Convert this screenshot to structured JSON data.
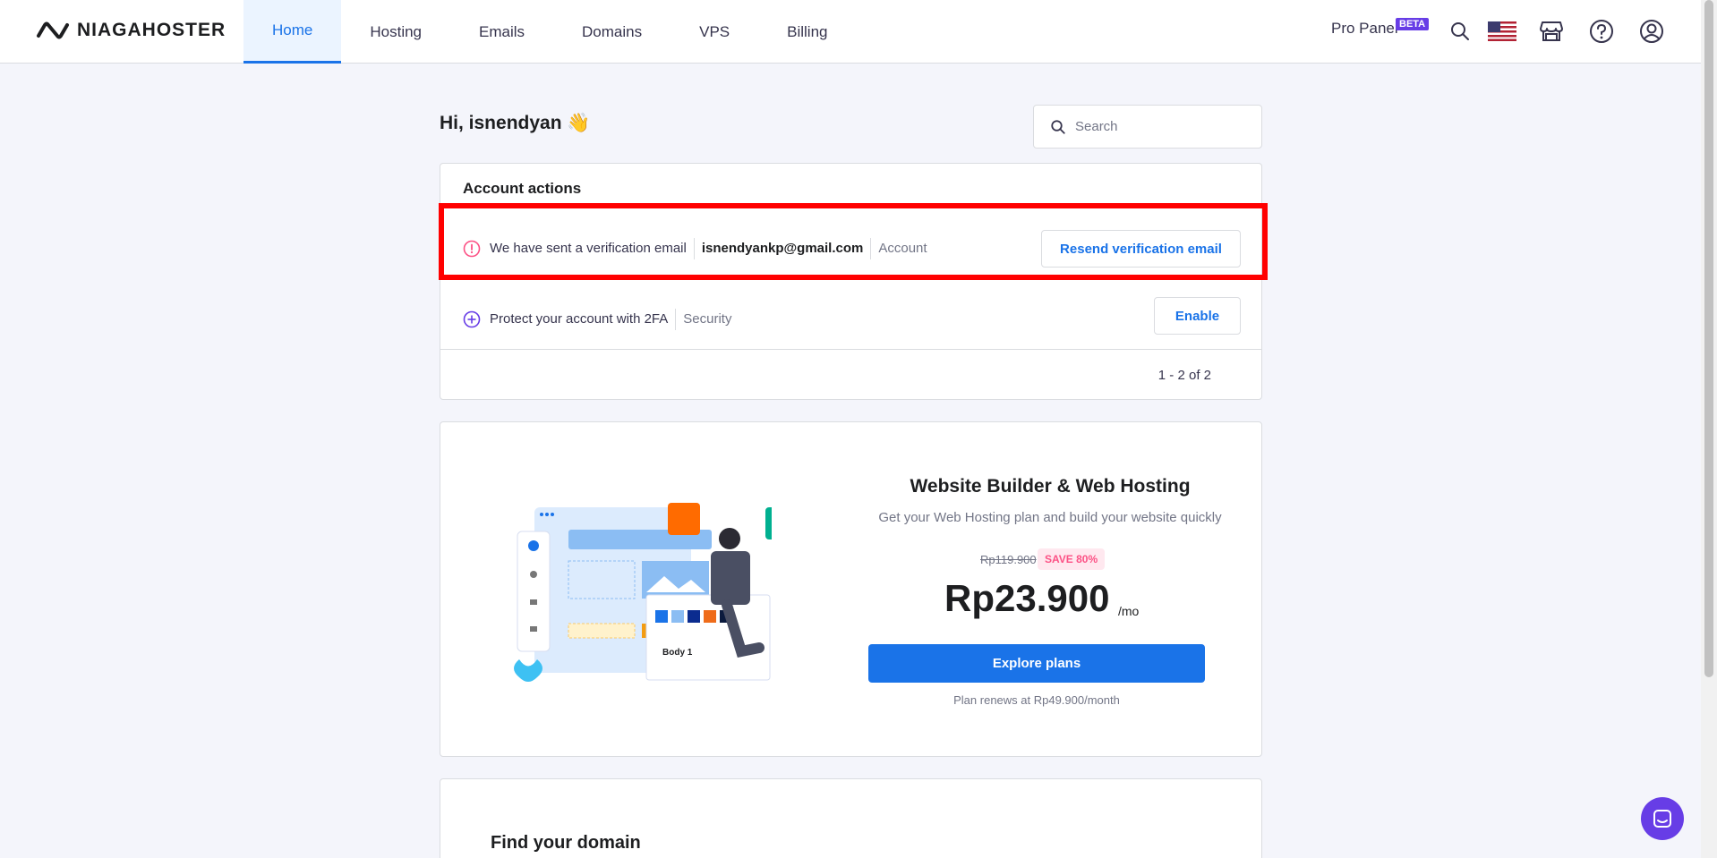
{
  "header": {
    "brand": "NIAGAHOSTER",
    "nav": [
      {
        "label": "Home",
        "active": true
      },
      {
        "label": "Hosting"
      },
      {
        "label": "Emails"
      },
      {
        "label": "Domains"
      },
      {
        "label": "VPS"
      },
      {
        "label": "Billing"
      }
    ],
    "pro_panel": "Pro Panel",
    "badge": "BETA",
    "icons": [
      "search-icon",
      "flag-us-icon",
      "store-icon",
      "help-icon",
      "account-icon"
    ]
  },
  "greeting": "Hi, isnendyan 👋",
  "search": {
    "placeholder": "Search"
  },
  "account_actions": {
    "title": "Account actions",
    "rows": [
      {
        "text": "We have sent a verification email",
        "email": "isnendyankp@gmail.com",
        "category": "Account",
        "button": "Resend verification email"
      },
      {
        "text": "Protect your account with 2FA",
        "category": "Security",
        "button": "Enable"
      }
    ],
    "pagination": "1 - 2 of 2"
  },
  "promo": {
    "title": "Website Builder & Web Hosting",
    "subtitle": "Get your Web Hosting plan and build your website quickly",
    "old_price": "Rp119.900",
    "save": "SAVE 80%",
    "price": "Rp23.900",
    "period": "/mo",
    "button": "Explore plans",
    "renew": "Plan renews at Rp49.900/month",
    "illustration_label": "Body 1"
  },
  "domain": {
    "title": "Find your domain"
  },
  "colors": {
    "accent": "#1a73e8",
    "brand": "#673de6",
    "highlight": "#ff0000"
  }
}
